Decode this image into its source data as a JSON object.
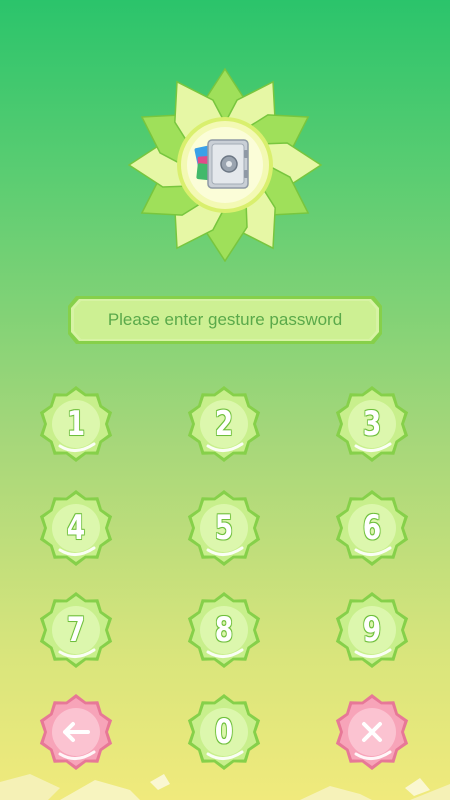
{
  "app": {
    "icon_name": "safe-vault-icon"
  },
  "prompt": {
    "text": "Please enter gesture password"
  },
  "keypad": {
    "keys": [
      {
        "label": "1",
        "type": "digit"
      },
      {
        "label": "2",
        "type": "digit"
      },
      {
        "label": "3",
        "type": "digit"
      },
      {
        "label": "4",
        "type": "digit"
      },
      {
        "label": "5",
        "type": "digit"
      },
      {
        "label": "6",
        "type": "digit"
      },
      {
        "label": "7",
        "type": "digit"
      },
      {
        "label": "8",
        "type": "digit"
      },
      {
        "label": "9",
        "type": "digit"
      },
      {
        "label": "",
        "type": "back",
        "icon": "arrow-left-icon"
      },
      {
        "label": "0",
        "type": "digit"
      },
      {
        "label": "",
        "type": "clear",
        "icon": "close-icon"
      }
    ]
  },
  "colors": {
    "key_green": "#c8ef8c",
    "key_green_rim": "#86d04a",
    "key_pink": "#f7a4b9",
    "key_pink_rim": "#e77897",
    "prompt_text": "#5aa94a",
    "background_top": "#2bc46b",
    "background_bottom": "#f0ea7c"
  }
}
